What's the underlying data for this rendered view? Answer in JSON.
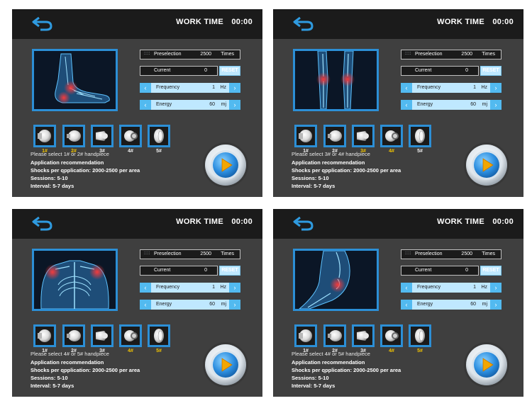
{
  "panels": [
    {
      "work_time_label": "WORK TIME",
      "work_time_value": "00:00",
      "image": "foot-illustration",
      "preselection": {
        "label": "Preselection",
        "value": "2500",
        "unit": "Times"
      },
      "current": {
        "label": "Current",
        "value": "0"
      },
      "reset_label": "RESET",
      "frequency": {
        "label": "Frequency",
        "value": "1",
        "unit": "Hz"
      },
      "energy": {
        "label": "Energy",
        "value": "60",
        "unit": "mj"
      },
      "handpieces": [
        {
          "label": "1#",
          "selected": true
        },
        {
          "label": "2#",
          "selected": true
        },
        {
          "label": "3#",
          "selected": false
        },
        {
          "label": "4#",
          "selected": false
        },
        {
          "label": "5#",
          "selected": false
        }
      ],
      "select_text": "Please select 1# or 2# handpiece",
      "recommendation_title": "Application recommendation",
      "shocks": "Shocks per qpplication:  2000-2500 per area",
      "sessions": "Sessions:  5-10",
      "interval": "Interval: 5-7 days"
    },
    {
      "work_time_label": "WORK TIME",
      "work_time_value": "00:00",
      "image": "knees-illustration",
      "preselection": {
        "label": "Preselection",
        "value": "2500",
        "unit": "Times"
      },
      "current": {
        "label": "Current",
        "value": "0"
      },
      "reset_label": "RESET",
      "frequency": {
        "label": "Frequency",
        "value": "1",
        "unit": "Hz"
      },
      "energy": {
        "label": "Energy",
        "value": "60",
        "unit": "mj"
      },
      "handpieces": [
        {
          "label": "1#",
          "selected": false
        },
        {
          "label": "2#",
          "selected": false
        },
        {
          "label": "3#",
          "selected": true
        },
        {
          "label": "4#",
          "selected": true
        },
        {
          "label": "5#",
          "selected": false
        }
      ],
      "select_text": "Please select 3# or 4# handpiece",
      "recommendation_title": "Application recommendation",
      "shocks": "Shocks per qpplication:  2000-2500 per area",
      "sessions": "Sessions:  5-10",
      "interval": "Interval: 5-7 days"
    },
    {
      "work_time_label": "WORK TIME",
      "work_time_value": "00:00",
      "image": "shoulders-illustration",
      "preselection": {
        "label": "Preselection",
        "value": "2500",
        "unit": "Times"
      },
      "current": {
        "label": "Current",
        "value": "0"
      },
      "reset_label": "RESET",
      "frequency": {
        "label": "Frequency",
        "value": "1",
        "unit": "Hz"
      },
      "energy": {
        "label": "Energy",
        "value": "60",
        "unit": "mj"
      },
      "handpieces": [
        {
          "label": "1#",
          "selected": false
        },
        {
          "label": "2#",
          "selected": false
        },
        {
          "label": "3#",
          "selected": false
        },
        {
          "label": "4#",
          "selected": true
        },
        {
          "label": "5#",
          "selected": true
        }
      ],
      "select_text": "Please select 4# or 5# handpiece",
      "recommendation_title": "Application recommendation",
      "shocks": "Shocks per qpplication:  2000-2500 per area",
      "sessions": "Sessions:  5-10",
      "interval": "Interval: 5-7 days"
    },
    {
      "work_time_label": "WORK TIME",
      "work_time_value": "00:00",
      "image": "hip-illustration",
      "preselection": {
        "label": "Preselection",
        "value": "2500",
        "unit": "Times"
      },
      "current": {
        "label": "Current",
        "value": "0"
      },
      "reset_label": "RESET",
      "frequency": {
        "label": "Frequency",
        "value": "1",
        "unit": "Hz"
      },
      "energy": {
        "label": "Energy",
        "value": "60",
        "unit": "mj"
      },
      "handpieces": [
        {
          "label": "1#",
          "selected": false
        },
        {
          "label": "2#",
          "selected": false
        },
        {
          "label": "3#",
          "selected": false
        },
        {
          "label": "4#",
          "selected": true
        },
        {
          "label": "5#",
          "selected": true
        }
      ],
      "select_text": "Please select 4# or 5# handpiece",
      "recommendation_title": "Application recommendation",
      "shocks": "Shocks per qpplication:  2000-2500 per area",
      "sessions": "Sessions:  5-10",
      "interval": "Interval: 5-7 days"
    }
  ],
  "colors": {
    "panel_bg": "#3f3f3f",
    "topbar_bg": "#1b1b1b",
    "accent_blue": "#2c8fd6",
    "light_blue": "#bfe8ff",
    "selected_label": "#f2c400"
  }
}
